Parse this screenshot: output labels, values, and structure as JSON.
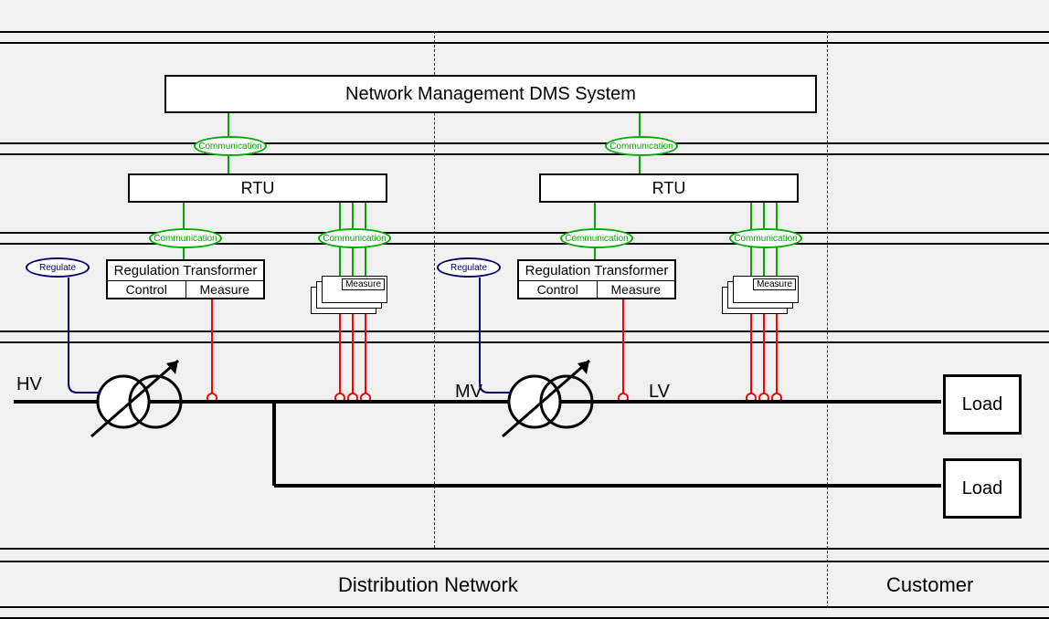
{
  "top_box": "Network Management DMS System",
  "rtu_left": "RTU",
  "rtu_right": "RTU",
  "comm": "Communication",
  "regulate": "Regulate",
  "reg_tx_title": "Regulation Transformer",
  "reg_control": "Control",
  "reg_measure": "Measure",
  "measure_card": "Measure",
  "hv": "HV",
  "mv": "MV",
  "lv": "LV",
  "load": "Load",
  "distribution": "Distribution Network",
  "customer": "Customer"
}
